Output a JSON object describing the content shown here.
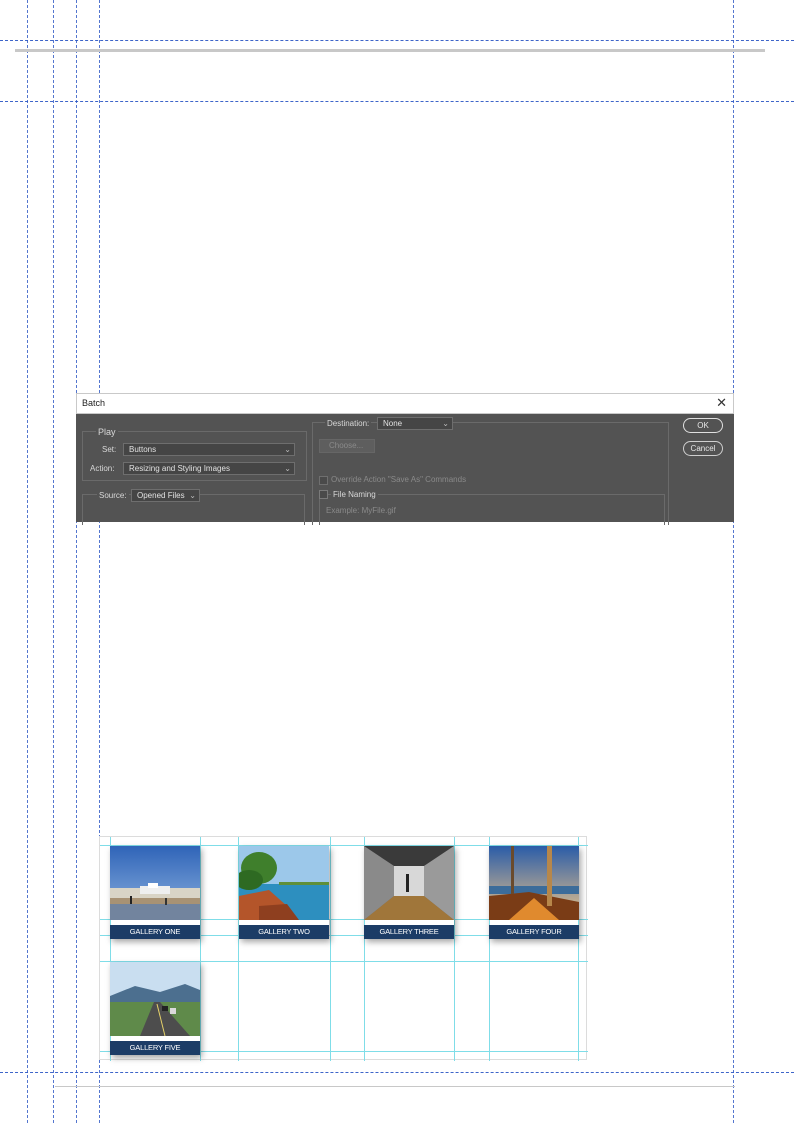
{
  "dialog": {
    "title": "Batch",
    "close_glyph": "✕",
    "play_label": "Play",
    "set_label": "Set:",
    "set_value": "Buttons",
    "action_label": "Action:",
    "action_value": "Resizing and Styling Images",
    "source_label": "Source:",
    "source_value": "Opened Files",
    "destination_label": "Destination:",
    "destination_value": "None",
    "choose_label": "Choose...",
    "override_label": "Override Action \"Save As\" Commands",
    "file_naming_label": "File Naming",
    "example_label": "Example: MyFile.gif",
    "ok_label": "OK",
    "cancel_label": "Cancel"
  },
  "gallery": {
    "tiles": [
      {
        "label": "GALLERY ONE",
        "icon": "beach-photo"
      },
      {
        "label": "GALLERY TWO",
        "icon": "lake-photo"
      },
      {
        "label": "GALLERY THREE",
        "icon": "corridor-photo"
      },
      {
        "label": "GALLERY FOUR",
        "icon": "sunset-photo"
      },
      {
        "label": "GALLERY FIVE",
        "icon": "road-photo"
      }
    ]
  },
  "colors": {
    "dialog_bg": "#535353",
    "caption_bg": "#1c3c66",
    "guide_blue": "#2a55c4",
    "grid_cyan": "#7fdde8"
  }
}
